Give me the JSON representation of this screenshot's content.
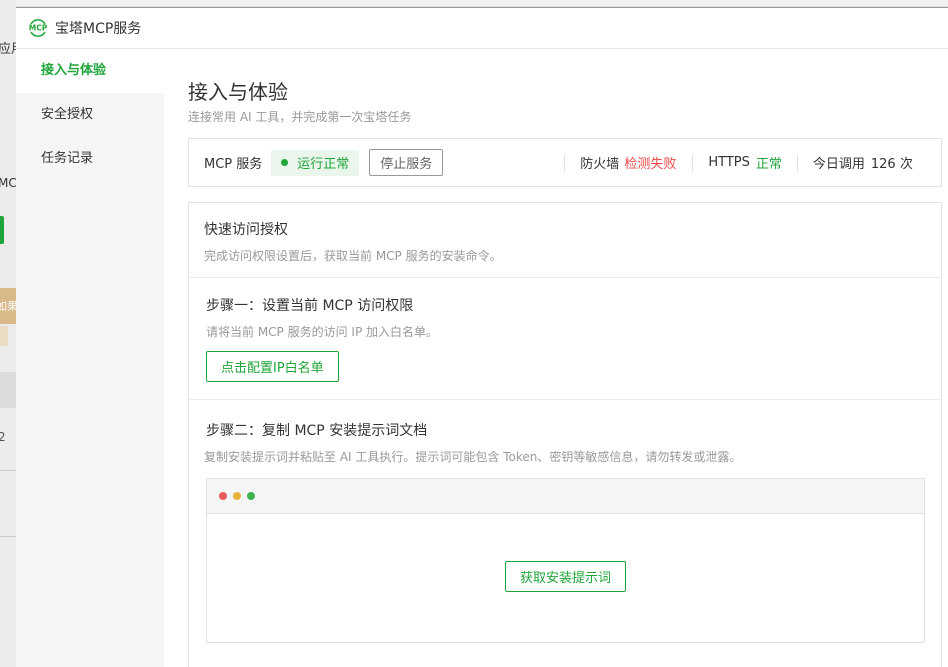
{
  "background": {
    "text_1": "应用",
    "text_2": "MC",
    "text_3": "如果",
    "text_4": "2"
  },
  "window": {
    "title": "宝塔MCP服务",
    "logo_text": "MCP"
  },
  "sidebar": {
    "items": [
      {
        "label": "接入与体验",
        "active": true
      },
      {
        "label": "安全授权",
        "active": false
      },
      {
        "label": "任务记录",
        "active": false
      }
    ]
  },
  "header": {
    "title": "接入与体验",
    "subtitle": "连接常用 AI 工具，并完成第一次宝塔任务"
  },
  "status": {
    "service_label": "MCP 服务",
    "running_label": "运行正常",
    "stop_button": "停止服务",
    "firewall_label": "防火墙",
    "firewall_value": "检测失败",
    "https_label": "HTTPS",
    "https_value": "正常",
    "calls_label": "今日调用",
    "calls_value": "126 次"
  },
  "quick_access": {
    "title": "快速访问授权",
    "desc": "完成访问权限设置后，获取当前 MCP 服务的安装命令。"
  },
  "step1": {
    "title": "步骤一：设置当前 MCP 访问权限",
    "desc": "请将当前 MCP 服务的访问 IP 加入白名单。",
    "button": "点击配置IP白名单"
  },
  "step2": {
    "title": "步骤二：复制 MCP 安装提示词文档",
    "desc": "复制安装提示词并粘贴至 AI 工具执行。提示词可能包含 Token、密钥等敏感信息，请勿转发或泄露。",
    "button": "获取安装提示词"
  },
  "colors": {
    "accent": "#20a53a",
    "error": "#ef4a4a",
    "traffic_red": "#e85a5a",
    "traffic_yellow": "#e8b23a",
    "traffic_green": "#3fb34f"
  }
}
